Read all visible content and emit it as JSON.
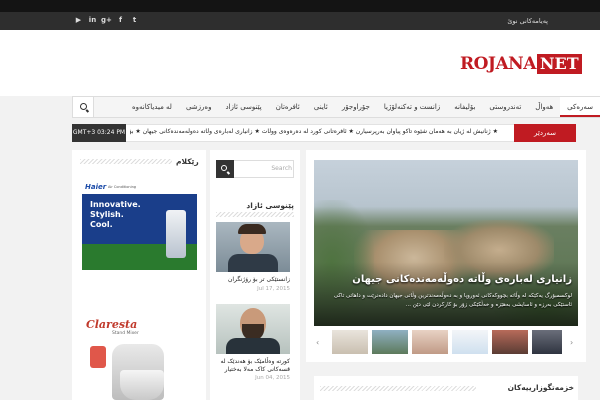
{
  "top_bar": {
    "link": "پەیامەکانی نوێ",
    "social": [
      {
        "icon": "youtube-icon",
        "glyph": "▶"
      },
      {
        "icon": "linkedin-icon",
        "glyph": "in"
      },
      {
        "icon": "google-plus-icon",
        "glyph": "g+"
      },
      {
        "icon": "facebook-icon",
        "glyph": "f"
      },
      {
        "icon": "twitter-icon",
        "glyph": "t"
      }
    ]
  },
  "logo": {
    "part1": "ROJANA",
    "part2": "NET"
  },
  "nav": {
    "items": [
      {
        "label": "سەرەکی",
        "active": true
      },
      {
        "label": "ھەواڵ",
        "active": false
      },
      {
        "label": "تەندروستی",
        "active": false
      },
      {
        "label": "بۆلیفانە",
        "active": false
      },
      {
        "label": "زانست و تەکنەلۆژیا",
        "active": false
      },
      {
        "label": "جۆراوجۆر",
        "active": false
      },
      {
        "label": "ئاینی",
        "active": false
      },
      {
        "label": "ئافرەتان",
        "active": false
      },
      {
        "label": "پێنوسی ئازاد",
        "active": false
      },
      {
        "label": "وەرزشی",
        "active": false
      },
      {
        "label": "لە میدیاکانەوە",
        "active": false
      }
    ]
  },
  "ticker": {
    "label": "سەردێر",
    "time": "GMT+3 03:24 PM",
    "text": "★ ژنانیش لە ژیان بە ھەمان شێوە تاکو پیاوان بەرپرسیارن ★ ئافرەتانی کورد لە دەرەوەی ووڵات ★ زانیاری لەبارەی وڵاتە دەوڵەمەندەکانی جیھان ★ بۆ ھاوسەرەکان (٢) چی وا لە پیاو دەکات کە ژنەکەی ئامێز بکات"
  },
  "left_sidebar": {
    "title": "رێکلام",
    "ad1": {
      "brand": "Haier",
      "brand_sub": "Air Conditioning",
      "line1": "Innovative.",
      "line2": "Stylish.",
      "line3": "Cool."
    },
    "ad2": {
      "brand": "Claresta",
      "sub": "Stand Mixer"
    }
  },
  "middle": {
    "search_placeholder": "Search",
    "title": "پێنوسی ئازاد",
    "posts": [
      {
        "title": "زانستێکی تر بۆ رۆژنگران",
        "date": "Jul 17, 2015"
      },
      {
        "title": "کورتە وەڵامێک بۆ ھەندێک لە قسەکانی کاک مەلا بەختیار",
        "date": "Jun 04, 2015"
      }
    ]
  },
  "slider": {
    "title": "زانیاری لەبارەی وڵاتە دەوڵەمەندەکانی جیھان",
    "text": "لوکسمبۆرگ یەکێکە لە وڵاتە بچووکەکانی ئەوروپا و بە دەوڵەمەندترین وڵاتی جیھان دادەنرێت و داھاتی تاکی ئاستێکی بەرزە و ئاسایشی بەھێزە و خەڵکێکی زۆر بۆ کارکردن لێی دێن ..."
  },
  "section2": {
    "title": "خزمەتگوزارییەکان"
  }
}
